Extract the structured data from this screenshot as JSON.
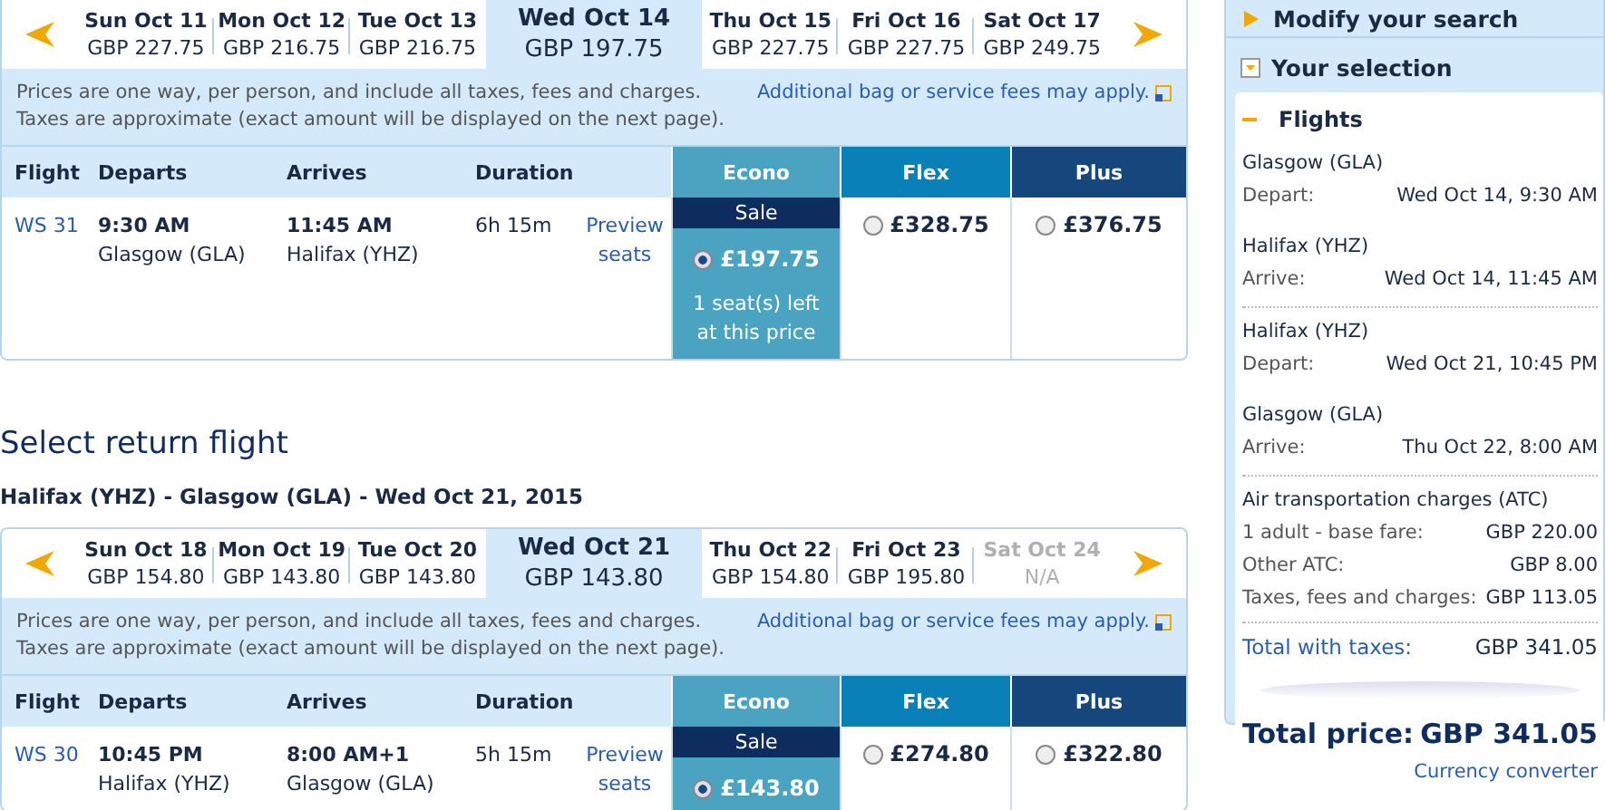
{
  "outbound": {
    "dates": [
      {
        "day": "Sun Oct 11",
        "price": "GBP 227.75",
        "selected": false,
        "available": true
      },
      {
        "day": "Mon Oct 12",
        "price": "GBP 216.75",
        "selected": false,
        "available": true
      },
      {
        "day": "Tue Oct 13",
        "price": "GBP 216.75",
        "selected": false,
        "available": true
      },
      {
        "day": "Wed Oct 14",
        "price": "GBP 197.75",
        "selected": true,
        "available": true
      },
      {
        "day": "Thu Oct 15",
        "price": "GBP 227.75",
        "selected": false,
        "available": true
      },
      {
        "day": "Fri Oct 16",
        "price": "GBP 227.75",
        "selected": false,
        "available": true
      },
      {
        "day": "Sat Oct 17",
        "price": "GBP 249.75",
        "selected": false,
        "available": true
      }
    ],
    "notice": [
      "Prices are one way, per person, and include all taxes, fees and charges.",
      "Taxes are approximate (exact amount will be displayed on the next page)."
    ],
    "fees_link": "Additional bag or service fees may apply.",
    "columns": [
      "Flight",
      "Departs",
      "Arrives",
      "Duration"
    ],
    "fare_columns": [
      "Econo",
      "Flex",
      "Plus"
    ],
    "flight": {
      "number": "WS 31",
      "depart_time": "9:30 AM",
      "depart_city": "Glasgow (GLA)",
      "arrive_time": "11:45 AM",
      "arrive_city": "Halifax (YHZ)",
      "duration": "6h 15m",
      "preview": "Preview seats",
      "fares": [
        {
          "price": "£197.75",
          "selected": true,
          "badge": "Sale",
          "note": "1 seat(s) left at this price"
        },
        {
          "price": "£328.75",
          "selected": false
        },
        {
          "price": "£376.75",
          "selected": false
        }
      ]
    }
  },
  "return_title": "Select return flight",
  "return_route": "Halifax (YHZ) - Glasgow (GLA) - Wed Oct 21, 2015",
  "return": {
    "dates": [
      {
        "day": "Sun Oct 18",
        "price": "GBP 154.80",
        "selected": false,
        "available": true
      },
      {
        "day": "Mon Oct 19",
        "price": "GBP 143.80",
        "selected": false,
        "available": true
      },
      {
        "day": "Tue Oct 20",
        "price": "GBP 143.80",
        "selected": false,
        "available": true
      },
      {
        "day": "Wed Oct 21",
        "price": "GBP 143.80",
        "selected": true,
        "available": true
      },
      {
        "day": "Thu Oct 22",
        "price": "GBP 154.80",
        "selected": false,
        "available": true
      },
      {
        "day": "Fri Oct 23",
        "price": "GBP 195.80",
        "selected": false,
        "available": true
      },
      {
        "day": "Sat Oct 24",
        "price": "N/A",
        "selected": false,
        "available": false
      }
    ],
    "notice": [
      "Prices are one way, per person, and include all taxes, fees and charges.",
      "Taxes are approximate (exact amount will be displayed on the next page)."
    ],
    "fees_link": "Additional bag or service fees may apply.",
    "columns": [
      "Flight",
      "Departs",
      "Arrives",
      "Duration"
    ],
    "fare_columns": [
      "Econo",
      "Flex",
      "Plus"
    ],
    "flight": {
      "number": "WS 30",
      "depart_time": "10:45 PM",
      "depart_city": "Halifax (YHZ)",
      "arrive_time": "8:00 AM+1",
      "arrive_city": "Glasgow (GLA)",
      "duration": "5h 15m",
      "preview": "Preview seats",
      "fares": [
        {
          "price": "£143.80",
          "selected": true,
          "badge": "Sale"
        },
        {
          "price": "£274.80",
          "selected": false
        },
        {
          "price": "£322.80",
          "selected": false
        }
      ]
    }
  },
  "sidebar": {
    "modify": "Modify your search",
    "selection_title": "Your selection",
    "flights_title": "Flights",
    "legs": [
      {
        "city": "Glasgow (GLA)",
        "label": "Depart:",
        "datetime": "Wed Oct 14, 9:30 AM"
      },
      {
        "city": "Halifax (YHZ)",
        "label": "Arrive:",
        "datetime": "Wed Oct 14, 11:45 AM"
      },
      {
        "city": "Halifax (YHZ)",
        "label": "Depart:",
        "datetime": "Wed Oct 21, 10:45 PM"
      },
      {
        "city": "Glasgow (GLA)",
        "label": "Arrive:",
        "datetime": "Thu Oct 22, 8:00 AM"
      }
    ],
    "charges_title": "Air transportation charges (ATC)",
    "charges": [
      {
        "label": "1 adult - base fare:",
        "value": "GBP 220.00"
      },
      {
        "label": "Other ATC:",
        "value": "GBP 8.00"
      },
      {
        "label": "Taxes, fees and charges:",
        "value": "GBP 113.05"
      }
    ],
    "total_with_taxes": {
      "label": "Total with taxes:",
      "value": "GBP 341.05"
    },
    "total_price": {
      "label": "Total price:",
      "value": "GBP 341.05"
    },
    "currency_link": "Currency converter"
  }
}
